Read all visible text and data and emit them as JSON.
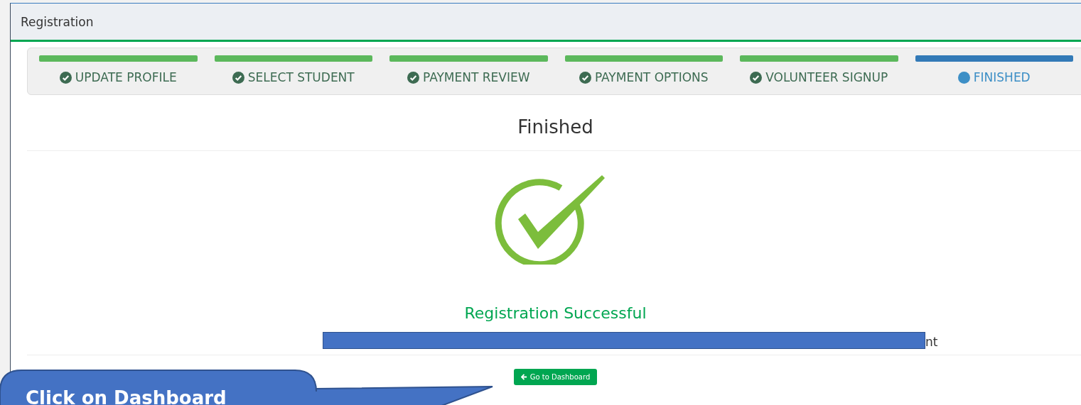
{
  "panel": {
    "title": "Registration"
  },
  "steps": [
    {
      "label": "UPDATE PROFILE",
      "completed": true
    },
    {
      "label": "SELECT STUDENT",
      "completed": true
    },
    {
      "label": "PAYMENT REVIEW",
      "completed": true
    },
    {
      "label": "PAYMENT OPTIONS",
      "completed": true
    },
    {
      "label": "VOLUNTEER SIGNUP",
      "completed": true
    },
    {
      "label": "FINISHED",
      "completed": false
    }
  ],
  "heading": "Finished",
  "message": {
    "title": "Registration Successful",
    "redacted_tail": "nt"
  },
  "button": {
    "label": "Go to Dashboard"
  },
  "callout": {
    "text": "Click on Dashboard"
  }
}
